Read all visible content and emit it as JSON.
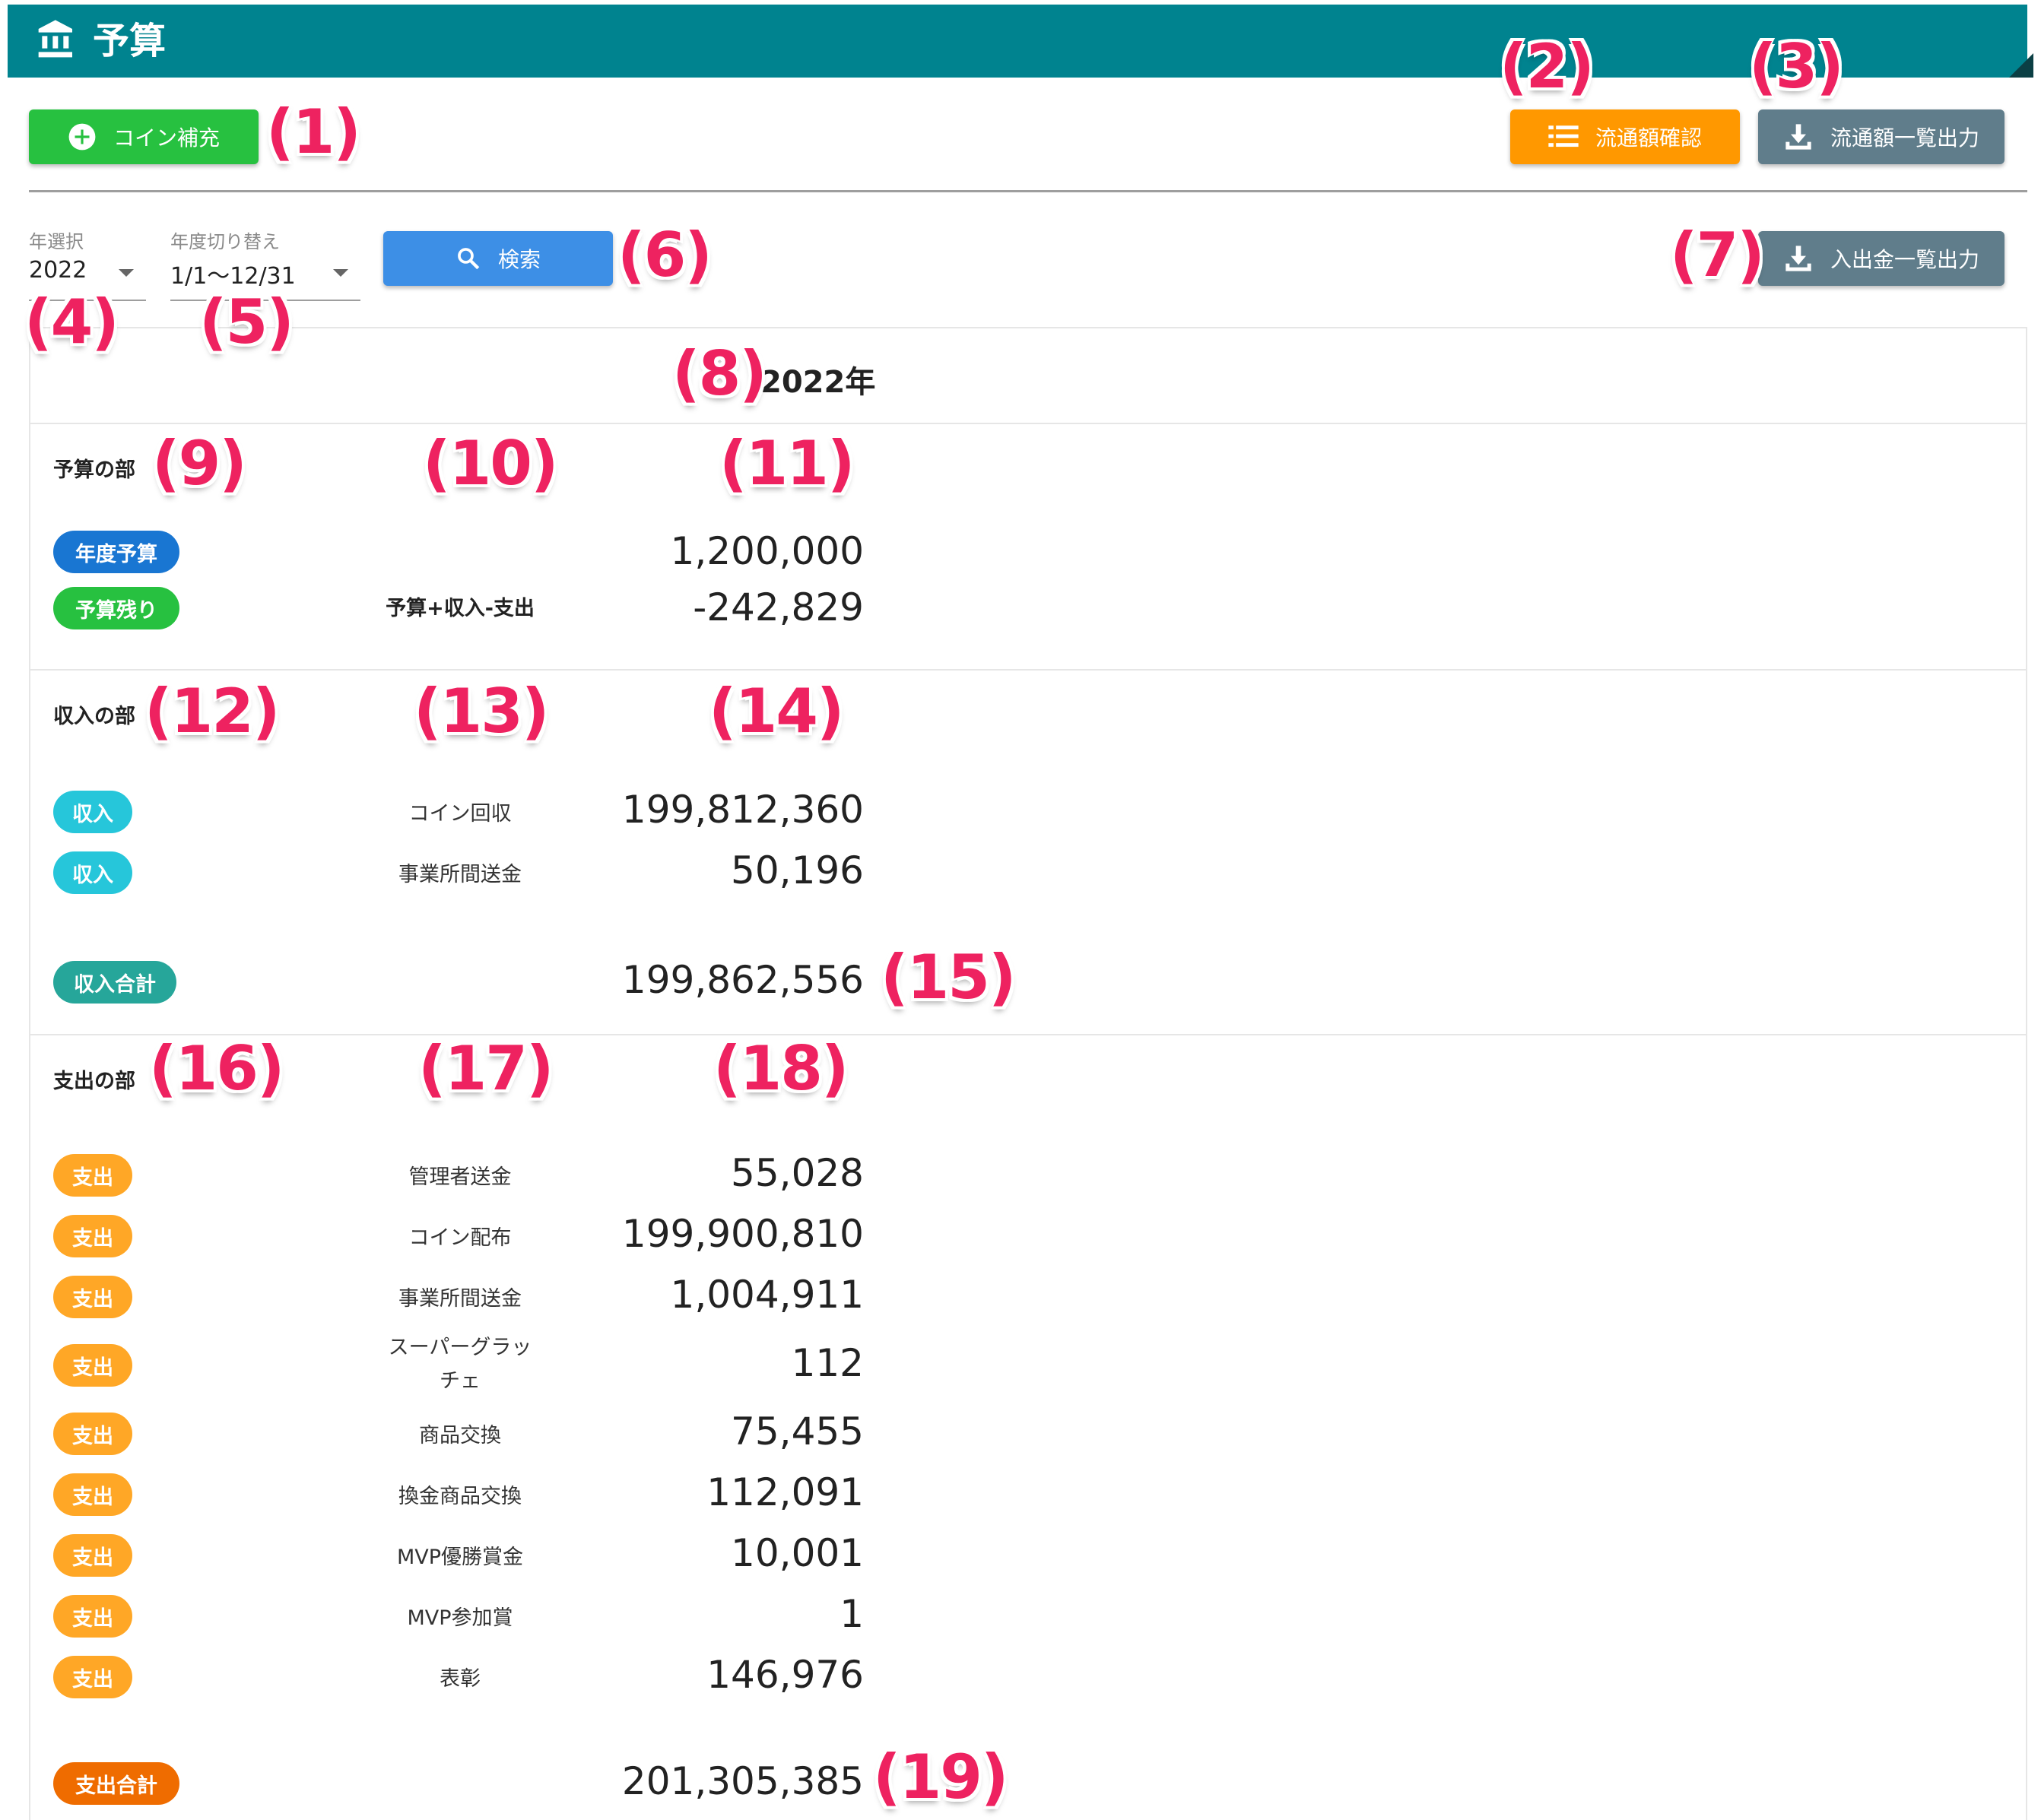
{
  "header": {
    "title": "予算",
    "icon": "bank-icon"
  },
  "toolbar": {
    "coin_refill_label": "コイン補充",
    "circulation_check_label": "流通額確認",
    "circulation_export_label": "流通額一覧出力",
    "deposit_export_label": "入出金一覧出力",
    "search_label": "検索"
  },
  "filters": {
    "year_label": "年選択",
    "year_value": "2022",
    "period_label": "年度切り替え",
    "period_value": "1/1〜12/31"
  },
  "report": {
    "year_heading": "2022年",
    "budget": {
      "title": "予算の部",
      "rows": [
        {
          "chip": "年度予算",
          "desc": "",
          "amount": "1,200,000"
        },
        {
          "chip": "予算残り",
          "desc": "予算+収入-支出",
          "amount": "-242,829"
        }
      ]
    },
    "income": {
      "title": "収入の部",
      "rows": [
        {
          "chip": "収入",
          "desc": "コイン回収",
          "amount": "199,812,360"
        },
        {
          "chip": "収入",
          "desc": "事業所間送金",
          "amount": "50,196"
        }
      ],
      "total_chip": "収入合計",
      "total_amount": "199,862,556"
    },
    "expense": {
      "title": "支出の部",
      "rows": [
        {
          "chip": "支出",
          "desc": "管理者送金",
          "amount": "55,028"
        },
        {
          "chip": "支出",
          "desc": "コイン配布",
          "amount": "199,900,810"
        },
        {
          "chip": "支出",
          "desc": "事業所間送金",
          "amount": "1,004,911"
        },
        {
          "chip": "支出",
          "desc_line1": "スーパーグラッ",
          "desc_line2": "チェ",
          "amount": "112"
        },
        {
          "chip": "支出",
          "desc": "商品交換",
          "amount": "75,455"
        },
        {
          "chip": "支出",
          "desc": "換金商品交換",
          "amount": "112,091"
        },
        {
          "chip": "支出",
          "desc": "MVP優勝賞金",
          "amount": "10,001"
        },
        {
          "chip": "支出",
          "desc": "MVP参加賞",
          "amount": "1"
        },
        {
          "chip": "支出",
          "desc": "表彰",
          "amount": "146,976"
        }
      ],
      "total_chip": "支出合計",
      "total_amount": "201,305,385"
    }
  },
  "annotations": [
    "(1)",
    "(2)",
    "(3)",
    "(4)",
    "(5)",
    "(6)",
    "(7)",
    "(8)",
    "(9)",
    "(10)",
    "(11)",
    "(12)",
    "(13)",
    "(14)",
    "(15)",
    "(16)",
    "(17)",
    "(18)",
    "(19)"
  ],
  "colors": {
    "header": "#00838f",
    "green": "#27c140",
    "orange": "#ff9800",
    "grey": "#607d8b",
    "blue": "#3d8fe6",
    "annotation": "#ee2260"
  }
}
